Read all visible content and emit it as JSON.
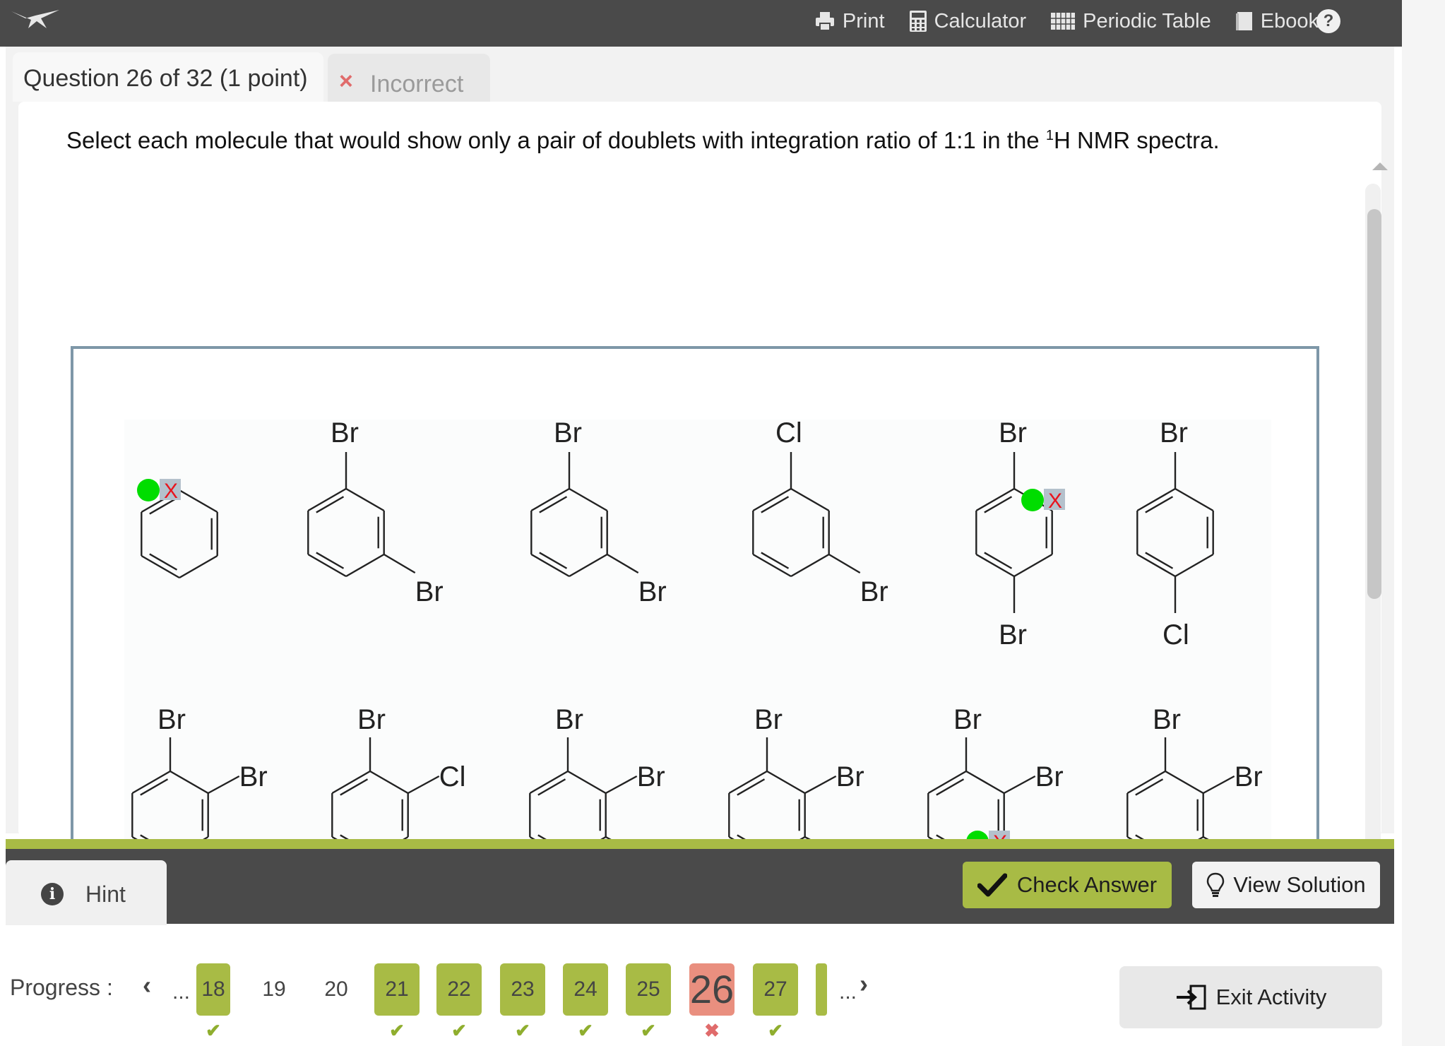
{
  "toolbar": {
    "print": "Print",
    "calculator": "Calculator",
    "periodic_table": "Periodic Table",
    "ebook": "Ebook",
    "help": "?"
  },
  "question": {
    "tab_label": "Question 26 of 32 (1 point)",
    "status_icon": "×",
    "status_label": "Incorrect",
    "prompt_before": "Select each molecule that would show only a pair of doublets with integration ratio of 1:1 in the ",
    "prompt_sup": "1",
    "prompt_after": "H NMR spectra."
  },
  "molecules": {
    "substituent_labels": {
      "row1": [
        "Br",
        "Br",
        "Br",
        "Br",
        "Cl",
        "Br",
        "Br",
        "Br",
        "Br",
        "Cl"
      ],
      "row2": [
        "Br",
        "Br",
        "Br",
        "Cl",
        "Br",
        "Br",
        "Br",
        "Br",
        "Br",
        "Br",
        "Br",
        "Br"
      ]
    },
    "selection_marker": "X"
  },
  "actions": {
    "hint": "Hint",
    "check_answer": "Check Answer",
    "view_solution": "View Solution"
  },
  "progress": {
    "label": "Progress :",
    "ellipsis": "...",
    "items": [
      {
        "num": "18",
        "status": "correct"
      },
      {
        "num": "19",
        "status": "none"
      },
      {
        "num": "20",
        "status": "none"
      },
      {
        "num": "21",
        "status": "correct"
      },
      {
        "num": "22",
        "status": "correct"
      },
      {
        "num": "23",
        "status": "correct"
      },
      {
        "num": "24",
        "status": "correct"
      },
      {
        "num": "25",
        "status": "correct"
      },
      {
        "num": "26",
        "status": "incorrect"
      },
      {
        "num": "27",
        "status": "correct"
      }
    ],
    "check_mark": "✔",
    "cross_mark": "✖"
  },
  "exit": {
    "label": "Exit Activity"
  },
  "colors": {
    "topbar": "#4a4a4a",
    "accent_green": "#a8bb45",
    "incorrect_red": "#e98f7f",
    "selection_green": "#00dd00",
    "selection_x": "#e8141e"
  },
  "icons": [
    "logo-bird-icon",
    "printer-icon",
    "calculator-icon",
    "periodic-table-icon",
    "book-icon",
    "help-icon",
    "info-icon",
    "check-icon",
    "lightbulb-icon",
    "exit-door-icon"
  ]
}
